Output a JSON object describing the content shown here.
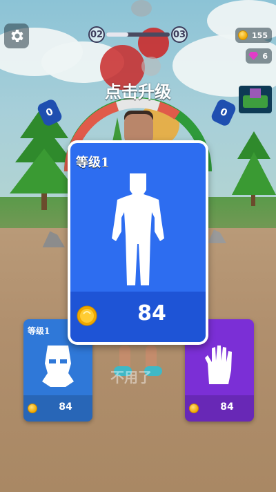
{
  "hud": {
    "settings_icon": "gear-icon",
    "level_current": "02",
    "level_next": "03",
    "level_progress": 0.35,
    "coins": "155",
    "gems": "6"
  },
  "title": "点击升级",
  "gauge_flags": [
    "0",
    "0"
  ],
  "skip_label": "不用了",
  "main_card": {
    "level_label": "等级1",
    "price": "84",
    "icon": "body-silhouette-icon",
    "color": "#2d6df0"
  },
  "side_cards": [
    {
      "level_label": "等级1",
      "price": "84",
      "icon": "mask-icon",
      "color": "#2f78d8"
    },
    {
      "level_label": "",
      "price": "84",
      "icon": "glove-icon",
      "color": "#7b2fd6"
    }
  ]
}
